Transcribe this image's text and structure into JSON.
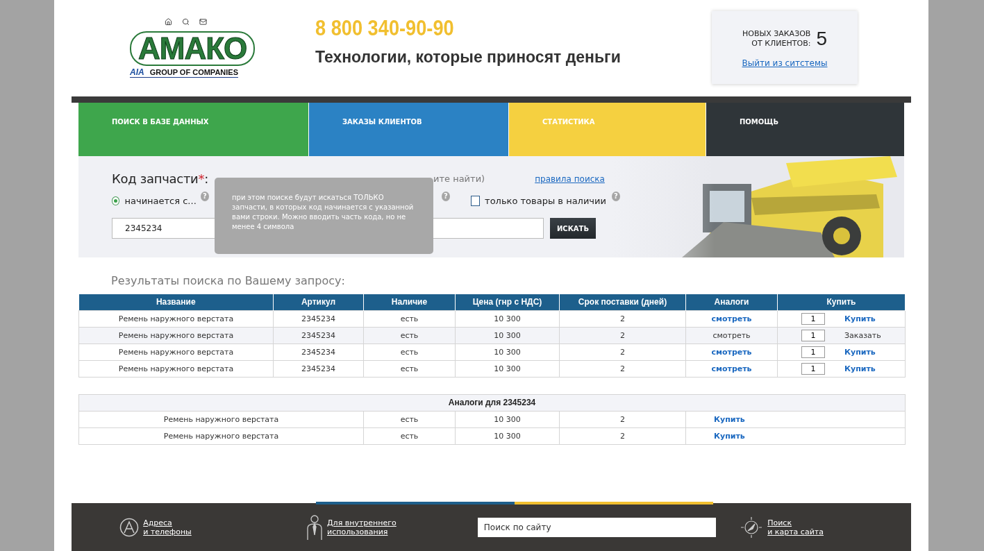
{
  "header": {
    "logo": {
      "word": "АМАКО",
      "badge": "AIA",
      "subtitle": "GROUP OF COMPANIES"
    },
    "phone": "8 800 340-90-90",
    "slogan": "Технологии, которые приносят деньги",
    "orders": {
      "label_1": "НОВЫХ ЗАКАЗОВ",
      "label_2": "ОТ КЛИЕНТОВ:",
      "count": "5",
      "logout": "Выйти из ситстемы"
    }
  },
  "nav": [
    {
      "label": "ПОИСК В БАЗЕ ДАННЫХ",
      "color": "#3ea64c"
    },
    {
      "label": "ЗАКАЗЫ КЛИЕНТОВ",
      "color": "#2b82c4"
    },
    {
      "label": "СТАТИСТИКА",
      "color": "#f5d040"
    },
    {
      "label": "ПОМОЩЬ",
      "color": "#2f3539"
    }
  ],
  "search": {
    "title": "Код запчасти",
    "required_mark": "*",
    "colon": ":",
    "hint_fragment": "ите найти)",
    "rules_link": "правила поиска",
    "radios": [
      {
        "label": "начинается с...",
        "selected": true
      }
    ],
    "in_stock": {
      "label": "только товары в наличии",
      "checked": false
    },
    "help_marks": [
      "?",
      "?",
      "?"
    ],
    "value": "2345234",
    "button": "ИСКАТЬ",
    "tooltip": "при этом поиске будут искаться ТОЛЬКО запчасти, в которых код начинается с указанной вами строки. Можно вводить часть кода, но не менее 4 символа"
  },
  "results": {
    "title": "Результаты поиска по Вашему запросу:",
    "columns": [
      "Название",
      "Артикул",
      "Наличие",
      "Цена (гнр с НДС)",
      "Срок поставки (дней)",
      "Аналоги",
      "Купить"
    ],
    "rows": [
      {
        "name": "Ремень наружного верстата",
        "article": "2345234",
        "stock": "есть",
        "price": "10 300",
        "days": "2",
        "highlighted": false,
        "analogs": {
          "label": "смотреть",
          "enabled": true
        },
        "quantity": "1",
        "action": {
          "label": "Купить",
          "kind": "buy"
        }
      },
      {
        "name": "Ремень наружного верстата",
        "article": "2345234",
        "stock": "есть",
        "price": "10 300",
        "days": "2",
        "highlighted": true,
        "analogs": {
          "label": "смотреть",
          "enabled": false
        },
        "quantity": "1",
        "action": {
          "label": "Заказать",
          "kind": "order"
        }
      },
      {
        "name": "Ремень наружного верстата",
        "article": "2345234",
        "stock": "есть",
        "price": "10 300",
        "days": "2",
        "highlighted": false,
        "analogs": {
          "label": "смотреть",
          "enabled": true
        },
        "quantity": "1",
        "action": {
          "label": "Купить",
          "kind": "buy"
        }
      },
      {
        "name": "Ремень наружного верстата",
        "article": "2345234",
        "stock": "есть",
        "price": "10 300",
        "days": "2",
        "highlighted": false,
        "analogs": {
          "label": "смотреть",
          "enabled": true
        },
        "quantity": "1",
        "action": {
          "label": "Купить",
          "kind": "buy"
        }
      }
    ]
  },
  "analogs": {
    "title": "Аналоги для 2345234",
    "rows": [
      {
        "name": "Ремень наружного верстата",
        "stock": "есть",
        "price": "10 300",
        "days": "2",
        "action": "Купить"
      },
      {
        "name": "Ремень наружного верстата",
        "stock": "есть",
        "price": "10 300",
        "days": "2",
        "action": "Купить"
      }
    ]
  },
  "footer": {
    "links": [
      {
        "kind": "contacts",
        "line_1": "Адреса",
        "line_2": "и телефоны"
      },
      {
        "kind": "internal",
        "line_1": "Для внутреннего",
        "line_2": "использования"
      },
      {
        "kind": "search",
        "placeholder": "Поиск по сайту"
      },
      {
        "kind": "sitemap",
        "line_1": "Поиск",
        "line_2": "и карта сайта"
      }
    ]
  }
}
